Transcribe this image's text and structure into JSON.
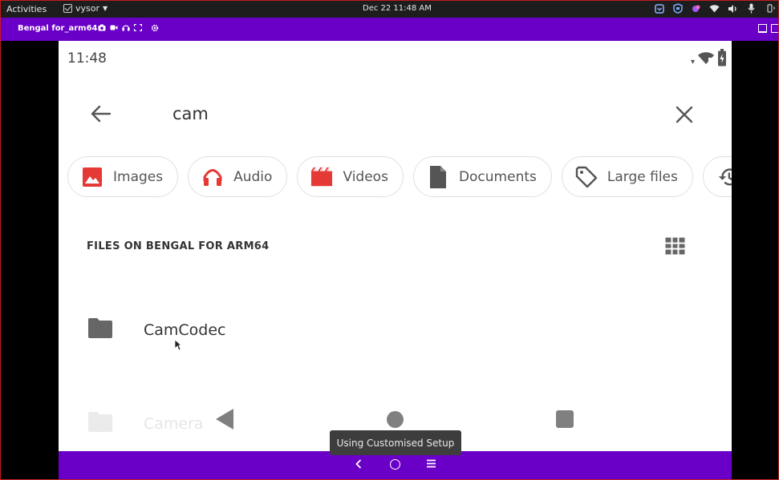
{
  "topbar": {
    "activities": "Activities",
    "app_name": "vysor",
    "clock": "Dec 22  11:48 AM",
    "tray_icons": [
      "shield-icon",
      "vpn-icon",
      "color-icon",
      "wifi-icon",
      "volume-icon",
      "mic-icon",
      "battery-icon"
    ]
  },
  "vysor": {
    "title": "Bengal for_arm64",
    "toolbar_icons": [
      "camera-icon",
      "video-icon",
      "headphones-icon",
      "fullscreen-icon",
      "settings-icon"
    ]
  },
  "device": {
    "status_time": "11:48",
    "search": {
      "query": "cam"
    },
    "chips": [
      {
        "label": "Images",
        "icon": "image-icon",
        "color": "#e53935"
      },
      {
        "label": "Audio",
        "icon": "headphones-icon",
        "color": "#e53935"
      },
      {
        "label": "Videos",
        "icon": "movie-icon",
        "color": "#e53935"
      },
      {
        "label": "Documents",
        "icon": "document-icon",
        "color": "#555555"
      },
      {
        "label": "Large files",
        "icon": "tag-icon",
        "color": "#555555"
      },
      {
        "label": "",
        "icon": "history-icon",
        "color": "#555555"
      }
    ],
    "section_title": "FILES ON BENGAL FOR ARM64",
    "files": [
      {
        "name": "CamCodec",
        "icon": "folder-icon"
      },
      {
        "name": "Camera",
        "icon": "folder-icon"
      }
    ]
  },
  "tooltip": "Using Customised Setup",
  "colors": {
    "accent": "#6a00c8",
    "chip_icon_red": "#e53935",
    "window_border": "#c31d1d"
  }
}
